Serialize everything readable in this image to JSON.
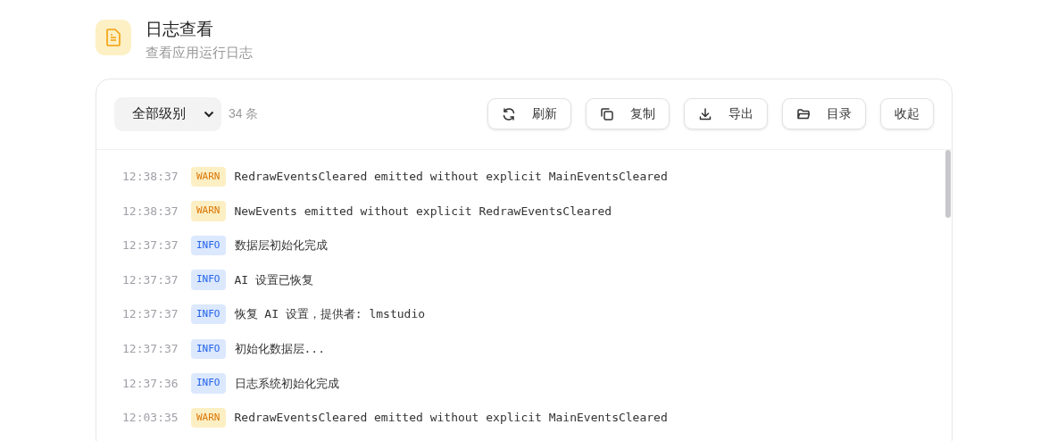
{
  "header": {
    "title": "日志查看",
    "subtitle": "查看应用运行日志"
  },
  "toolbar": {
    "level_filter": "全部级别",
    "count": "34 条",
    "buttons": [
      {
        "label": "刷新",
        "kind": "refresh"
      },
      {
        "label": "复制",
        "kind": "copy"
      },
      {
        "label": "导出",
        "kind": "export"
      },
      {
        "label": "目录",
        "kind": "folder"
      },
      {
        "label": "收起",
        "kind": "plain"
      }
    ]
  },
  "logs": [
    {
      "time": "12:38:37",
      "level": "WARN",
      "message": "RedrawEventsCleared emitted without explicit MainEventsCleared"
    },
    {
      "time": "12:38:37",
      "level": "WARN",
      "message": "NewEvents emitted without explicit RedrawEventsCleared"
    },
    {
      "time": "12:37:37",
      "level": "INFO",
      "message": "数据层初始化完成"
    },
    {
      "time": "12:37:37",
      "level": "INFO",
      "message": "AI 设置已恢复"
    },
    {
      "time": "12:37:37",
      "level": "INFO",
      "message": "恢复 AI 设置，提供者: lmstudio"
    },
    {
      "time": "12:37:37",
      "level": "INFO",
      "message": "初始化数据层..."
    },
    {
      "time": "12:37:36",
      "level": "INFO",
      "message": "日志系统初始化完成"
    },
    {
      "time": "12:03:35",
      "level": "WARN",
      "message": "RedrawEventsCleared emitted without explicit MainEventsCleared"
    }
  ]
}
